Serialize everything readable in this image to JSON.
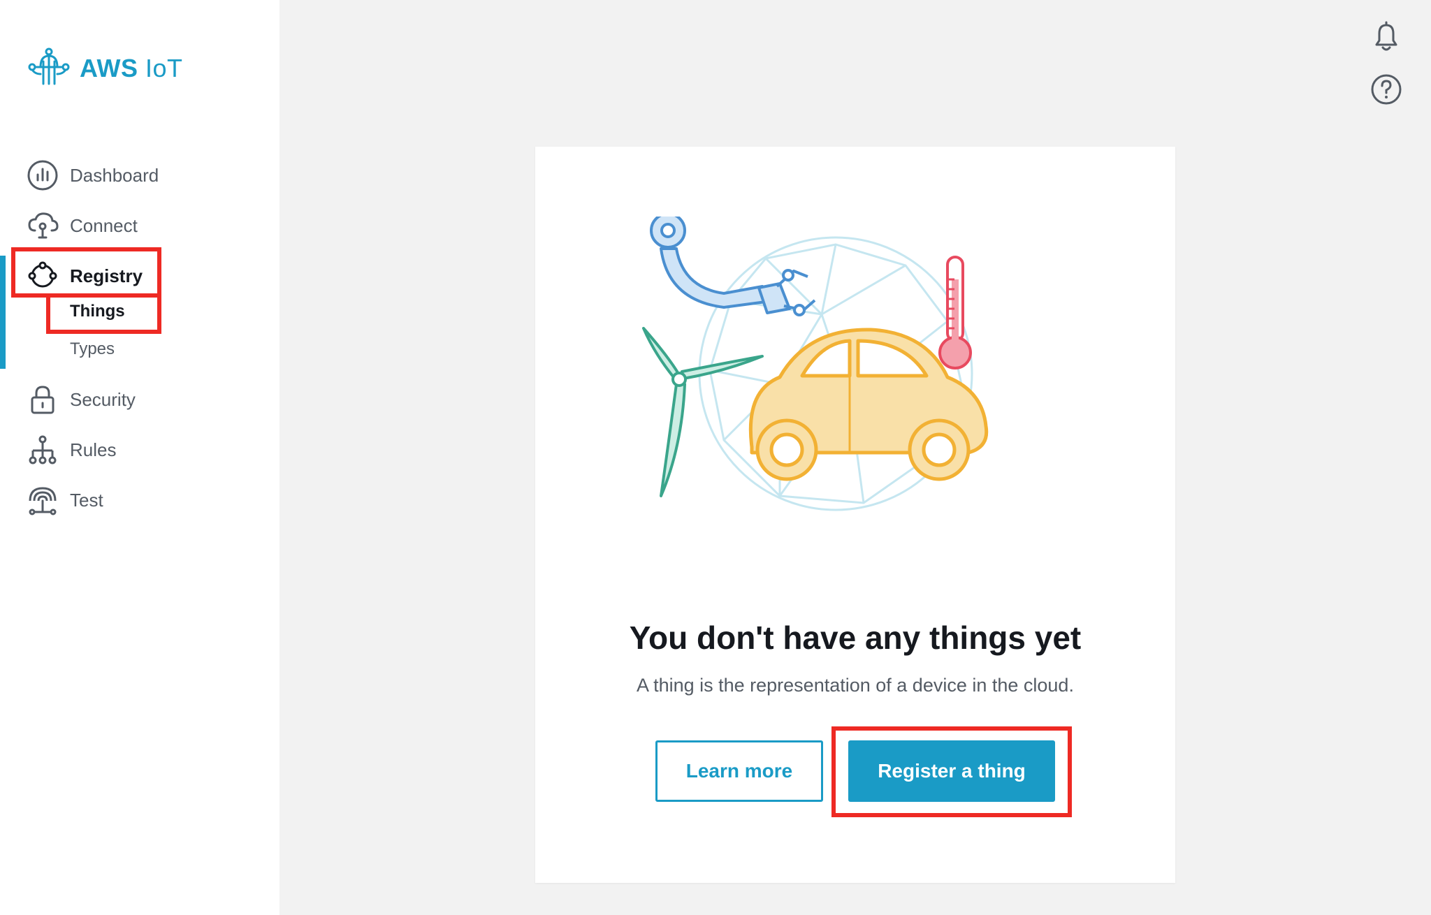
{
  "brand": {
    "name_bold": "AWS",
    "name_rest": " IoT",
    "color": "#1a9bc6"
  },
  "sidebar": {
    "items": [
      {
        "label": "Dashboard",
        "icon": "bar-chart-icon"
      },
      {
        "label": "Connect",
        "icon": "cloud-connect-icon"
      },
      {
        "label": "Registry",
        "icon": "registry-icon",
        "active": true
      },
      {
        "label": "Security",
        "icon": "lock-icon"
      },
      {
        "label": "Rules",
        "icon": "hierarchy-icon"
      },
      {
        "label": "Test",
        "icon": "signal-icon"
      }
    ],
    "registry_sub": [
      {
        "label": "Things",
        "active": true
      },
      {
        "label": "Types"
      }
    ]
  },
  "topbar": {
    "notification_icon": "bell-icon",
    "help_icon": "help-icon"
  },
  "empty_state": {
    "title": "You don't have any things yet",
    "description": "A thing is the representation of a device in the cloud.",
    "secondary_button": "Learn more",
    "primary_button": "Register a thing"
  },
  "colors": {
    "accent": "#1a9bc6",
    "highlight": "#ee2a24",
    "text_dark": "#16191f",
    "text_muted": "#545b64"
  }
}
